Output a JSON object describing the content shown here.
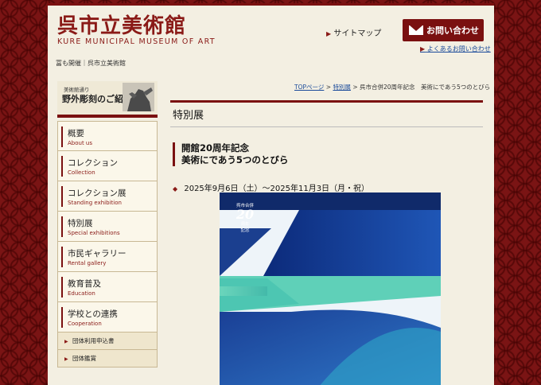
{
  "header": {
    "logo_jp": "呉市立美術館",
    "logo_en": "KURE MUNICIPAL MUSEUM OF ART",
    "sitemap_label": "サイトマップ",
    "contact_label": "お問い合わせ",
    "faq_label": "よくあるお問い合わせ",
    "ticker": "冨も開催｜呉市立美術館"
  },
  "banner": {
    "subtitle": "美術館通り",
    "title": "野外彫刻のご紹介"
  },
  "breadcrumb": {
    "home": "TOPページ",
    "sep1": ">",
    "parent": "特別展",
    "sep2": ">",
    "current": "呉市合併20周年記念　美術にであう5つのとびら"
  },
  "main": {
    "page_title": "特別展",
    "exhibition_title_line1": "開館20周年記念",
    "exhibition_title_line2": "美術にであう5つのとびら",
    "date": "2025年9月6日（土）～2025年11月3日（月・祝）"
  },
  "poster": {
    "badge_top": "呉市合併",
    "badge_num": "20",
    "badge_unit": "周年",
    "badge_bottom": "記念",
    "colors": {
      "navy": "#0e2a6e",
      "blue": "#1d4fa6",
      "mint": "#5fd0b0",
      "light": "#e9f1f8"
    }
  },
  "sidebar": {
    "items": [
      {
        "jp": "概要",
        "en": "About us"
      },
      {
        "jp": "コレクション",
        "en": "Collection"
      },
      {
        "jp": "コレクション展",
        "en": "Standing exhibition"
      },
      {
        "jp": "特別展",
        "en": "Special exhibitions"
      },
      {
        "jp": "市民ギャラリー",
        "en": "Rental gallery"
      },
      {
        "jp": "教育普及",
        "en": "Education"
      },
      {
        "jp": "学校との連携",
        "en": "Cooperation"
      }
    ],
    "subitems": [
      "団体利用申込書",
      "団体鑑賞"
    ]
  },
  "colors": {
    "brand": "#7a1010",
    "link": "#1a4a9a",
    "page_bg": "#f3efe2"
  }
}
